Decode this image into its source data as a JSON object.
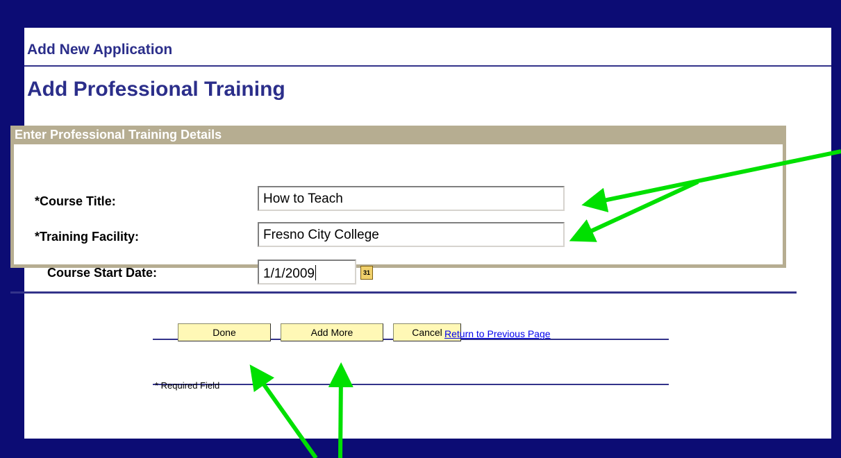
{
  "header": {
    "app_title": "Add New Application",
    "page_title": "Add Professional Training"
  },
  "form": {
    "section_title": "Enter Professional Training Details",
    "course_title_label": "*Course Title:",
    "course_title_value": "How to Teach",
    "training_facility_label": "*Training Facility:",
    "training_facility_value": "Fresno City College",
    "start_date_label": "Course Start Date:",
    "start_date_value": "1/1/2009",
    "calendar_icon_text": "31"
  },
  "actions": {
    "done_label": "Done",
    "add_more_label": "Add More",
    "cancel_label": "Cancel",
    "return_link": "Return to Previous Page"
  },
  "footer": {
    "required_note": "* Required Field"
  },
  "colors": {
    "frame": "#0c0c74",
    "title_text": "#2b2e8a",
    "group_header": "#b6ad91",
    "button_bg": "#fff8b6",
    "annotation_arrow": "#00e000"
  }
}
